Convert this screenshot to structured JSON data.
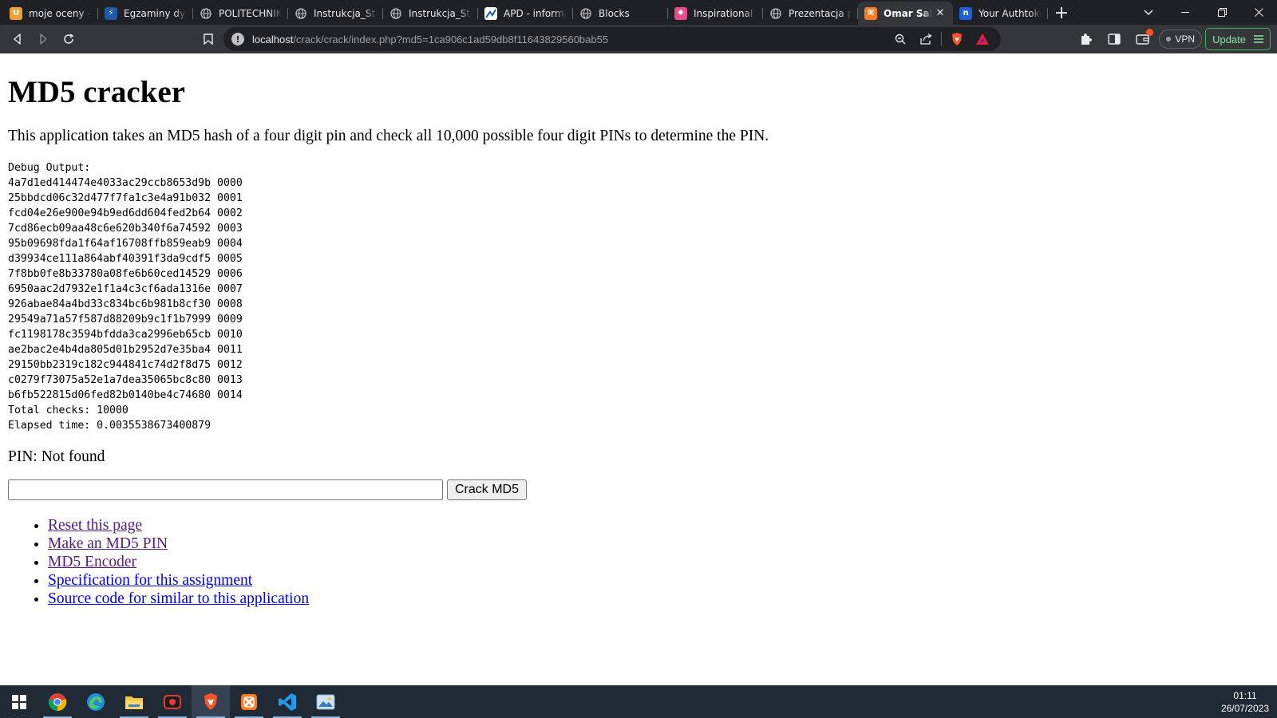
{
  "browser": {
    "tabs": [
      {
        "title": "moje oceny - oc",
        "icon": "usos-icon",
        "color": "#f0a030",
        "glyph": "U"
      },
      {
        "title": "Egzaminy dyplo",
        "icon": "bolt-icon",
        "color": "#1e5aa8",
        "glyph": "⚡"
      },
      {
        "title": "POLITECHNIKA",
        "icon": "globe-icon",
        "color": "#5f6368",
        "glyph": ""
      },
      {
        "title": "Instrukcja_Stude",
        "icon": "globe-icon",
        "color": "#5f6368",
        "glyph": ""
      },
      {
        "title": "Instrukcja_Stude",
        "icon": "globe-icon",
        "color": "#5f6368",
        "glyph": ""
      },
      {
        "title": "APD - informacj",
        "icon": "apd-icon",
        "color": "#ffffff",
        "glyph": ""
      },
      {
        "title": "Blocks",
        "icon": "globe-icon",
        "color": "#5f6368",
        "glyph": ""
      },
      {
        "title": "Inspirational Qu",
        "icon": "pinwheel-icon",
        "color": "#e84a8a",
        "glyph": "✸"
      },
      {
        "title": "Prezentacja pro",
        "icon": "globe-icon",
        "color": "#5f6368",
        "glyph": ""
      },
      {
        "title": "Omar Sallo",
        "icon": "xampp-icon",
        "color": "#fb7a24",
        "glyph": "⌘",
        "active": true
      },
      {
        "title": "Your Authtoken",
        "icon": "ngrok-icon",
        "color": "#1f5fd8",
        "glyph": "n"
      }
    ],
    "url_host": "localhost",
    "url_path": "/crack/crack/index.php?md5=1ca906c1ad59db8f11643829560bab55",
    "vpn_label": "VPN",
    "update_label": "Update"
  },
  "page": {
    "title": "MD5 cracker",
    "intro": "This application takes an MD5 hash of a four digit pin and check all 10,000 possible four digit PINs to determine the PIN.",
    "debug_lines": [
      "Debug Output:",
      "4a7d1ed414474e4033ac29ccb8653d9b 0000",
      "25bbdcd06c32d477f7fa1c3e4a91b032 0001",
      "fcd04e26e900e94b9ed6dd604fed2b64 0002",
      "7cd86ecb09aa48c6e620b340f6a74592 0003",
      "95b09698fda1f64af16708ffb859eab9 0004",
      "d39934ce111a864abf40391f3da9cdf5 0005",
      "7f8bb0fe8b33780a08fe6b60ced14529 0006",
      "6950aac2d7932e1f1a4c3cf6ada1316e 0007",
      "926abae84a4bd33c834bc6b981b8cf30 0008",
      "29549a71a57f587d88209b9c1f1b7999 0009",
      "fc1198178c3594bfdda3ca2996eb65cb 0010",
      "ae2bac2e4b4da805d01b2952d7e35ba4 0011",
      "29150bb2319c182c944841c74d2f8d75 0012",
      "c0279f73075a52e1a7dea35065bc8c80 0013",
      "b6fb522815d06fed82b0140be4c74680 0014",
      "Total checks: 10000",
      "Elapsed time: 0.0035538673400879"
    ],
    "pin_result": "PIN: Not found",
    "md5_input_value": "",
    "crack_button": "Crack MD5",
    "links": [
      {
        "label": "Reset this page",
        "visited": true
      },
      {
        "label": "Make an MD5 PIN",
        "visited": true
      },
      {
        "label": "MD5 Encoder",
        "visited": true
      },
      {
        "label": "Specification for this assignment",
        "visited": false
      },
      {
        "label": "Source code for similar to this application",
        "visited": false
      }
    ]
  },
  "taskbar": {
    "apps": [
      {
        "name": "start-menu-icon"
      },
      {
        "name": "chrome-icon",
        "running": true
      },
      {
        "name": "edge-icon"
      },
      {
        "name": "file-explorer-icon",
        "running": true
      },
      {
        "name": "screen-recorder-icon",
        "running": true
      },
      {
        "name": "brave-icon",
        "running": true,
        "active": true
      },
      {
        "name": "xampp-icon",
        "running": true
      },
      {
        "name": "vscode-icon",
        "running": true
      },
      {
        "name": "photos-icon",
        "running": true
      }
    ],
    "time": "01:11",
    "date": "26/07/2023"
  }
}
